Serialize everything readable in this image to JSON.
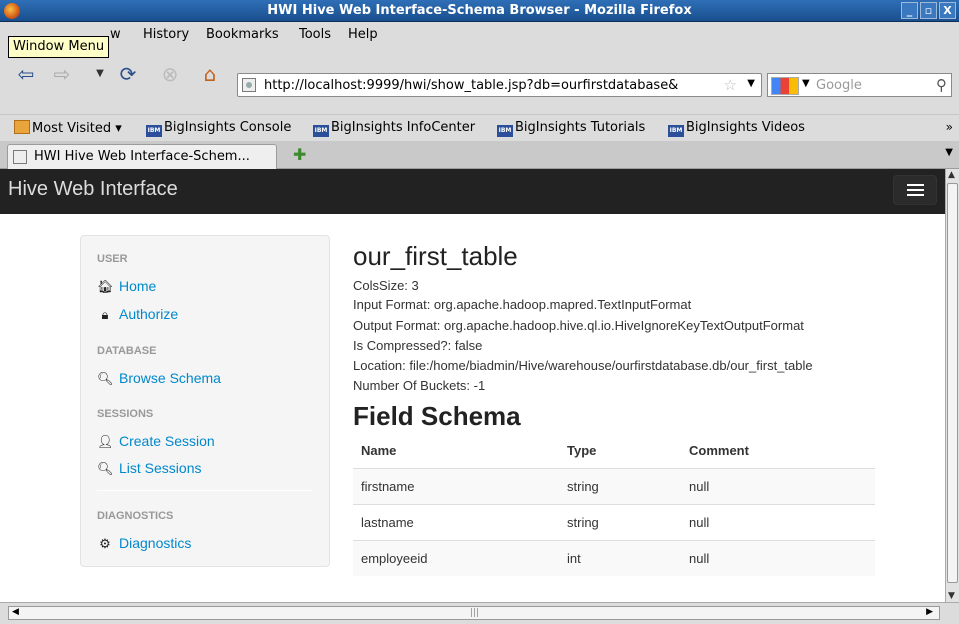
{
  "window": {
    "title": "HWI Hive Web Interface-Schema Browser - Mozilla Firefox",
    "minimize": "_",
    "maximize": "▫",
    "close": "X"
  },
  "menu": {
    "tooltip": "Window Menu",
    "view_partial": "w",
    "history": "History",
    "bookmarks": "Bookmarks",
    "tools": "Tools",
    "help": "Help"
  },
  "toolbar": {
    "url": "http://localhost:9999/hwi/show_table.jsp?db=ourfirstdatabase&",
    "search_placeholder": "Google"
  },
  "bookmarks": {
    "most_visited": "Most Visited",
    "items": [
      "BigInsights Console",
      "BigInsights InfoCenter",
      "BigInsights Tutorials",
      "BigInsights Videos"
    ],
    "ibm_badge": "IBM",
    "more": "»"
  },
  "tabs": {
    "active_label": "HWI Hive Web Interface-Schem..."
  },
  "app": {
    "brand": "Hive Web Interface"
  },
  "sidebar": {
    "user_header": "USER",
    "home": "Home",
    "authorize": "Authorize",
    "database_header": "DATABASE",
    "browse_schema": "Browse Schema",
    "sessions_header": "SESSIONS",
    "create_session": "Create Session",
    "list_sessions": "List Sessions",
    "diagnostics_header": "DIAGNOSTICS",
    "diagnostics": "Diagnostics"
  },
  "table": {
    "name": "our_first_table",
    "cols_size": "ColsSize: 3",
    "input_format": "Input Format: org.apache.hadoop.mapred.TextInputFormat",
    "output_format": "Output Format: org.apache.hadoop.hive.ql.io.HiveIgnoreKeyTextOutputFormat",
    "is_compressed": "Is Compressed?: false",
    "location": "Location: file:/home/biadmin/Hive/warehouse/ourfirstdatabase.db/our_first_table",
    "buckets": "Number Of Buckets: -1"
  },
  "field_schema": {
    "title": "Field Schema",
    "headers": [
      "Name",
      "Type",
      "Comment"
    ],
    "rows": [
      [
        "firstname",
        "string",
        "null"
      ],
      [
        "lastname",
        "string",
        "null"
      ],
      [
        "employeeid",
        "int",
        "null"
      ]
    ]
  }
}
